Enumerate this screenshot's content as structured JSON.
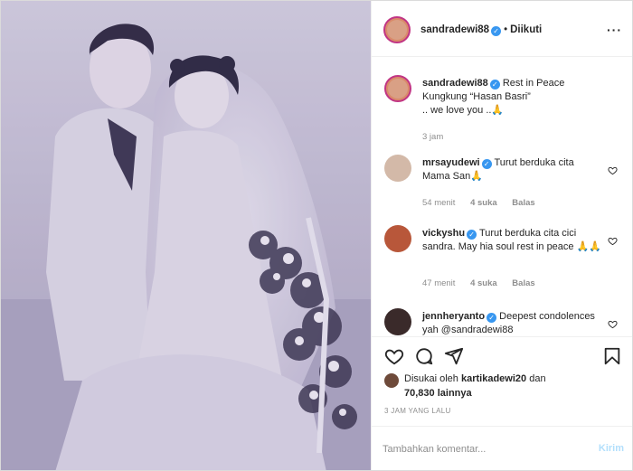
{
  "header": {
    "username": "sandradewi88",
    "separator": "•",
    "follow_status": "Diikuti",
    "more_icon": "more-horizontal-icon"
  },
  "caption": {
    "username": "sandradewi88",
    "text_line1": "Rest in Peace",
    "text_line2": "Kungkung “Hasan Basri”",
    "text_line3": ".. we love you ..🙏",
    "time": "3 jam"
  },
  "comments": [
    {
      "username": "mrsayudewi",
      "text": "Turut berduka cita Mama San🙏",
      "time": "54 menit",
      "likes": "4 suka",
      "reply": "Balas"
    },
    {
      "username": "vickyshu",
      "text": "Turut berduka cita cici sandra. May hia soul rest in peace 🙏🙏",
      "time": "47 menit",
      "likes": "4 suka",
      "reply": "Balas"
    },
    {
      "username": "jennheryanto",
      "text": "Deepest condolences yah @sandradewi88"
    }
  ],
  "actions": {
    "like_icon": "heart-icon",
    "comment_icon": "comment-icon",
    "share_icon": "send-icon",
    "save_icon": "bookmark-icon"
  },
  "likes": {
    "prefix": "Disukai oleh",
    "user": "kartikadewi20",
    "connector": "dan",
    "count": "70,830",
    "suffix": "lainnya"
  },
  "post_time": "3 JAM YANG LALU",
  "add_comment": {
    "placeholder": "Tambahkan komentar...",
    "post_label": "Kirim"
  },
  "colors": {
    "verified": "#3897f0",
    "story_ring": "#c13584",
    "muted": "#8e8e8e",
    "post_button_disabled": "#b2dffc"
  }
}
